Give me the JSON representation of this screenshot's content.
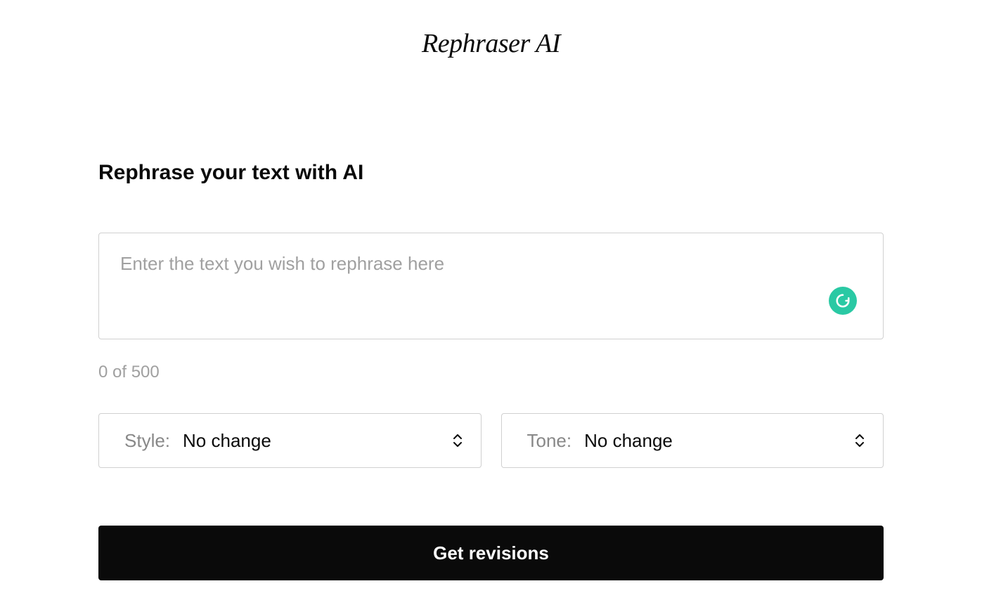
{
  "app": {
    "title": "Rephraser AI"
  },
  "main": {
    "heading": "Rephrase your text with AI",
    "textarea": {
      "placeholder": "Enter the text you wish to rephrase here",
      "value": ""
    },
    "char_count": "0 of 500",
    "style_select": {
      "label": "Style:",
      "value": "No change"
    },
    "tone_select": {
      "label": "Tone:",
      "value": "No change"
    },
    "submit_label": "Get revisions"
  }
}
